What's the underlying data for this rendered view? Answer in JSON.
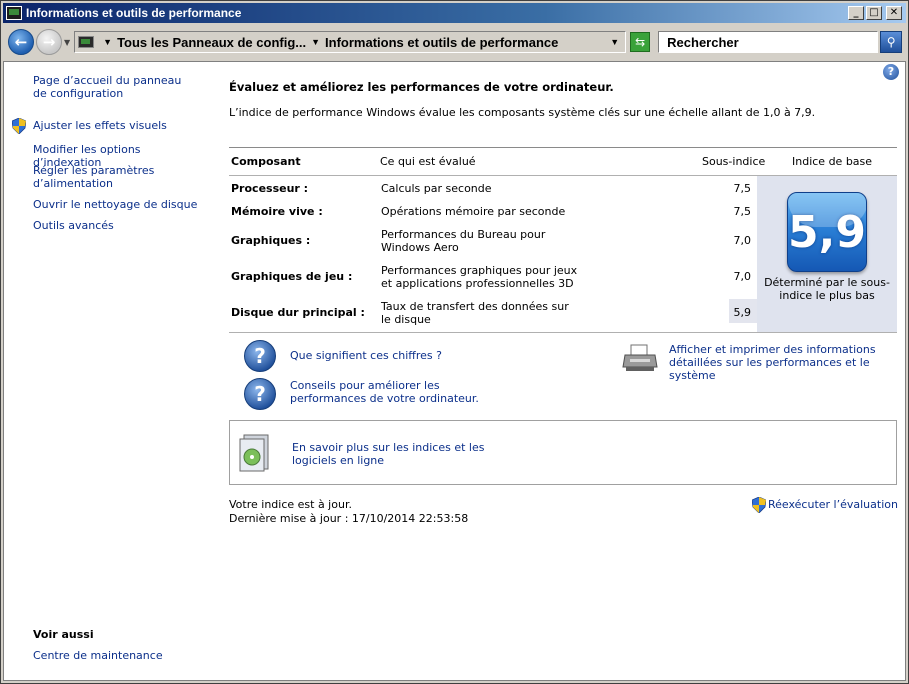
{
  "window": {
    "title": "Informations et outils de performance",
    "buttons": {
      "minimize": "_",
      "maximize": "□",
      "close": "✕"
    }
  },
  "navbar": {
    "breadcrumbs": [
      "Tous les Panneaux de config...",
      "Informations et outils de performance"
    ],
    "search_placeholder": "Rechercher"
  },
  "sidebar": {
    "items": [
      {
        "label": "Page d’accueil du panneau de configuration"
      },
      {
        "label": "Ajuster les effets visuels"
      },
      {
        "label": "Modifier les options d’indexation"
      },
      {
        "label": "Régler les paramètres d’alimentation"
      },
      {
        "label": "Ouvrir le nettoyage de disque"
      },
      {
        "label": "Outils avancés"
      }
    ],
    "see_also_title": "Voir aussi",
    "see_also_items": [
      {
        "label": "Centre de maintenance"
      }
    ]
  },
  "main": {
    "heading": "Évaluez et améliorez les performances de votre ordinateur.",
    "intro": "L’indice de performance Windows évalue les composants système clés sur une échelle allant de 1,0 à 7,9.",
    "table": {
      "headers": {
        "component": "Composant",
        "what": "Ce qui est évalué",
        "subscore": "Sous-indice",
        "base": "Indice de base"
      },
      "rows": [
        {
          "component": "Processeur :",
          "what": "Calculs par seconde",
          "subscore": "7,5"
        },
        {
          "component": "Mémoire vive :",
          "what": "Opérations mémoire par seconde",
          "subscore": "7,5"
        },
        {
          "component": "Graphiques :",
          "what": "Performances du Bureau pour Windows Aero",
          "subscore": "7,0"
        },
        {
          "component": "Graphiques de jeu :",
          "what": "Performances graphiques pour jeux et applications professionnelles 3D",
          "subscore": "7,0"
        },
        {
          "component": "Disque dur principal :",
          "what": "Taux de transfert des données sur le disque",
          "subscore": "5,9"
        }
      ],
      "base_score": "5,9",
      "base_caption": "Déterminé par le sous-indice le plus bas"
    },
    "links": {
      "what_numbers_mean": "Que signifient ces chiffres ?",
      "tips": "Conseils pour améliorer les performances de votre ordinateur.",
      "print_details": "Afficher et imprimer des informations détaillées sur les performances et le système",
      "learn_more": "En savoir plus sur les indices et les logiciels en ligne"
    },
    "status": {
      "up_to_date": "Votre indice est à jour.",
      "last_update": "Dernière mise à jour : 17/10/2014 22:53:58",
      "rerun": "Réexécuter l’évaluation"
    }
  },
  "icons": {
    "help": "?",
    "question": "?",
    "back": "←",
    "forward": "→",
    "search": "⚲",
    "refresh": "⇆"
  },
  "colors": {
    "link": "#0b2f8a",
    "badge": "#2a7fd6",
    "base_panel": "#dfe3ee",
    "title_bar": "#0a246a"
  }
}
